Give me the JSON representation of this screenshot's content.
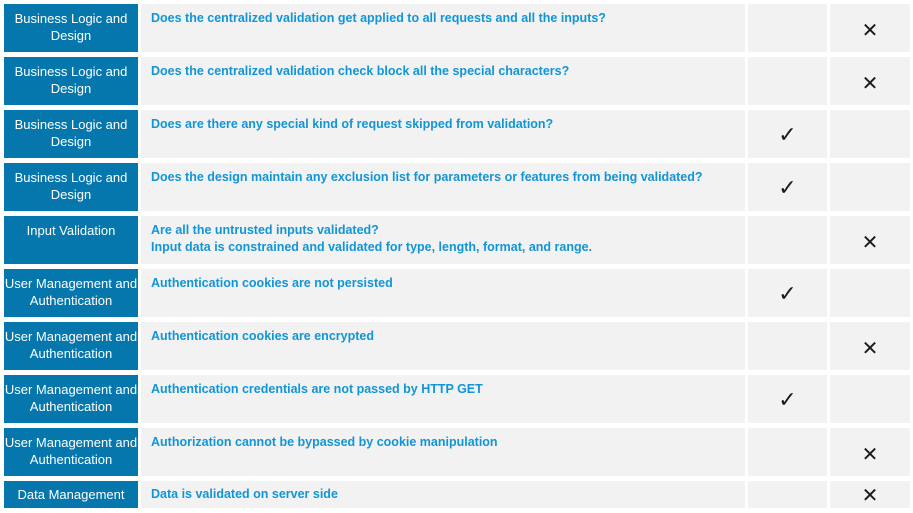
{
  "rows": [
    {
      "category": "Business Logic and Design",
      "question": "Does the centralized validation get applied to all requests and all the inputs?",
      "yes": "",
      "no": "✕"
    },
    {
      "category": "Business Logic and Design",
      "question": "Does the centralized validation check block all the special characters?",
      "yes": "",
      "no": "✕"
    },
    {
      "category": "Business Logic and Design",
      "question": "Does are there any special kind of request skipped from validation?",
      "yes": "✓",
      "no": ""
    },
    {
      "category": "Business Logic and Design",
      "question": "Does the design maintain any exclusion list for parameters or features from being validated?",
      "yes": "✓",
      "no": ""
    },
    {
      "category": "Input Validation",
      "question": "Are all the untrusted inputs validated?\nInput data is constrained and validated for type, length, format, and range.",
      "yes": "",
      "no": "✕"
    },
    {
      "category": "User Management and Authentication",
      "question": "Authentication cookies are not persisted",
      "yes": "✓",
      "no": ""
    },
    {
      "category": "User Management and Authentication",
      "question": "Authentication cookies are encrypted",
      "yes": "",
      "no": "✕"
    },
    {
      "category": "User Management and Authentication",
      "question": "Authentication credentials are not passed by HTTP GET",
      "yes": "✓",
      "no": ""
    },
    {
      "category": "User Management and Authentication",
      "question": "Authorization cannot be bypassed by cookie manipulation",
      "yes": "",
      "no": "✕"
    },
    {
      "category": "Data Management",
      "question": "Data is validated on server side",
      "yes": "",
      "no": "✕"
    }
  ]
}
